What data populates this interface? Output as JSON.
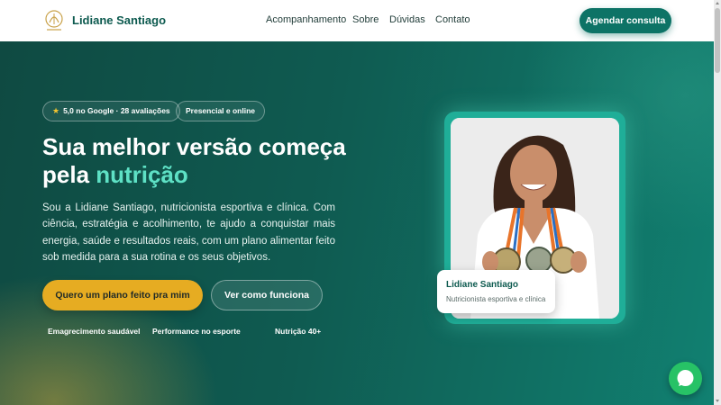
{
  "header": {
    "brand": "Lidiane Santiago",
    "nav": [
      "Acompanhamento",
      "Sobre",
      "Dúvidas",
      "Contato"
    ],
    "cta": "Agendar consulta"
  },
  "hero": {
    "badges": {
      "rating": "5,0 no Google · 28 avaliações",
      "mode": "Presencial e online"
    },
    "title_line1": "Sua melhor versão começa",
    "title_line2_prefix": "pela ",
    "title_line2_accent": "nutrição",
    "paragraph": "Sou a Lidiane Santiago, nutricionista esportiva e clínica. Com ciência, estratégia e acolhimento, te ajudo a conquistar mais energia, saúde e resultados reais, com um plano alimentar feito sob medida para a sua rotina e os seus objetivos.",
    "primary_button": "Quero um plano feito pra mim",
    "secondary_button": "Ver como funciona",
    "features": [
      "Emagrecimento saudável",
      "Performance no esporte",
      "Nutrição 40+"
    ]
  },
  "profile_card": {
    "name": "Lidiane Santiago",
    "role": "Nutricionista esportiva e clínica"
  },
  "colors": {
    "primary": "#0d7366",
    "accent_text": "#5ee1c5",
    "cta_yellow": "#e6ac22",
    "whatsapp": "#27c266"
  },
  "icons": [
    "logo-icon",
    "star-icon",
    "whatsapp-icon"
  ]
}
